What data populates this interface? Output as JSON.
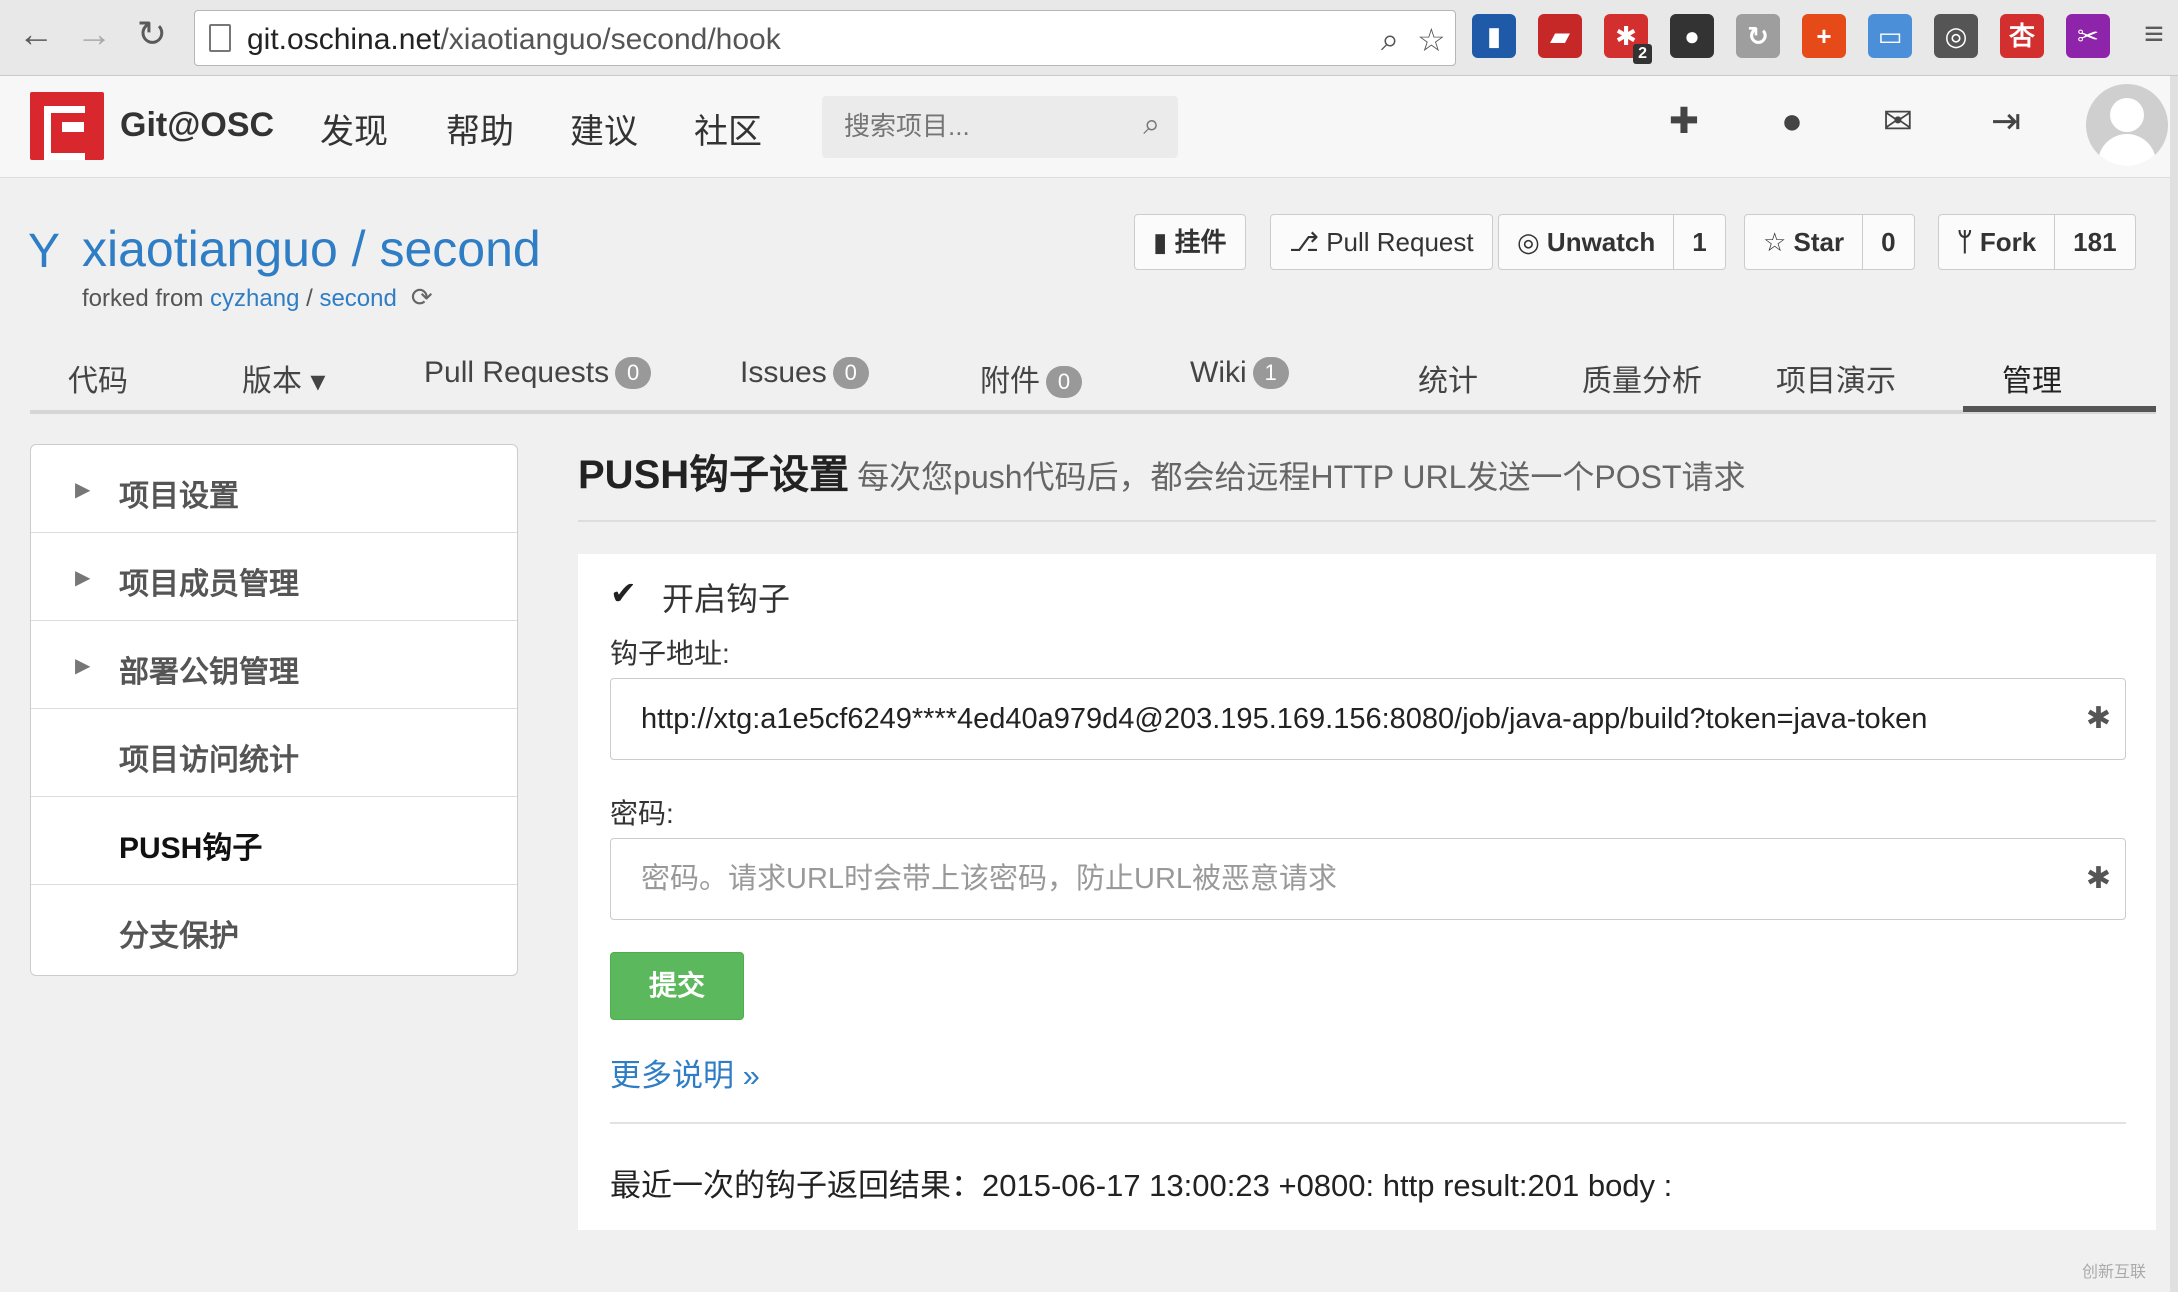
{
  "browser": {
    "url_host": "git.oschina.net",
    "url_path": "/xiaotianguo/second/hook",
    "extensions": [
      {
        "name": "chart-extension-icon",
        "glyph": "▮",
        "color": "#1e5aa8"
      },
      {
        "name": "pdf-extension-icon",
        "glyph": "▰",
        "color": "#c62828"
      },
      {
        "name": "flower-extension-icon",
        "glyph": "✱",
        "color": "#d32f2f",
        "badge": "2"
      },
      {
        "name": "evernote-extension-icon",
        "glyph": "●",
        "color": "#333333"
      },
      {
        "name": "sync-extension-icon",
        "glyph": "↻",
        "color": "#9e9e9e"
      },
      {
        "name": "plus-extension-icon",
        "glyph": "+",
        "color": "#e64a19"
      },
      {
        "name": "window-extension-icon",
        "glyph": "▭",
        "color": "#4a8fd8"
      },
      {
        "name": "film-extension-icon",
        "glyph": "◎",
        "color": "#555555"
      },
      {
        "name": "apricot-extension-icon",
        "glyph": "杏",
        "color": "#d32f2f"
      },
      {
        "name": "scissors-extension-icon",
        "glyph": "✂",
        "color": "#8e24aa"
      }
    ]
  },
  "header": {
    "brand": "Git@OSC",
    "nav": [
      "发现",
      "帮助",
      "建议",
      "社区"
    ],
    "search_placeholder": "搜索项目..."
  },
  "project": {
    "owner": "xiaotianguo",
    "separator": " / ",
    "name": "second",
    "forked_prefix": "forked from ",
    "forked_owner": "cyzhang",
    "forked_sep": " / ",
    "forked_repo": "second",
    "buttons": {
      "plugin": "挂件",
      "pull_request": "Pull Request",
      "unwatch": "Unwatch",
      "unwatch_count": "1",
      "star": "Star",
      "star_count": "0",
      "fork": "Fork",
      "fork_count": "181"
    }
  },
  "tabs": [
    {
      "label": "代码"
    },
    {
      "label": "版本 ▾"
    },
    {
      "label": "Pull Requests",
      "count": "0"
    },
    {
      "label": "Issues",
      "count": "0"
    },
    {
      "label": "附件",
      "count": "0"
    },
    {
      "label": "Wiki",
      "count": "1"
    },
    {
      "label": "统计"
    },
    {
      "label": "质量分析"
    },
    {
      "label": "项目演示"
    },
    {
      "label": "管理",
      "active": true
    }
  ],
  "sidebar": {
    "items": [
      {
        "label": "项目设置",
        "expandable": true
      },
      {
        "label": "项目成员管理",
        "expandable": true
      },
      {
        "label": "部署公钥管理",
        "expandable": true
      },
      {
        "label": "项目访问统计",
        "expandable": false
      },
      {
        "label": "PUSH钩子",
        "expandable": false,
        "active": true
      },
      {
        "label": "分支保护",
        "expandable": false
      }
    ]
  },
  "main": {
    "title": "PUSH钩子设置",
    "subtitle": "每次您push代码后，都会给远程HTTP URL发送一个POST请求",
    "enable_checked": true,
    "enable_label": "开启钩子",
    "url_label": "钩子地址:",
    "url_value": "http://xtg:a1e5cf6249****4ed40a979d4@203.195.169.156:8080/job/java-app/build?token=java-token",
    "password_label": "密码:",
    "password_placeholder": "密码。请求URL时会带上该密码，防止URL被恶意请求",
    "submit_label": "提交",
    "more_link": "更多说明 »",
    "last_result": "最近一次的钩子返回结果：2015-06-17 13:00:23 +0800: http result:201 body :"
  },
  "watermark": "创新互联"
}
